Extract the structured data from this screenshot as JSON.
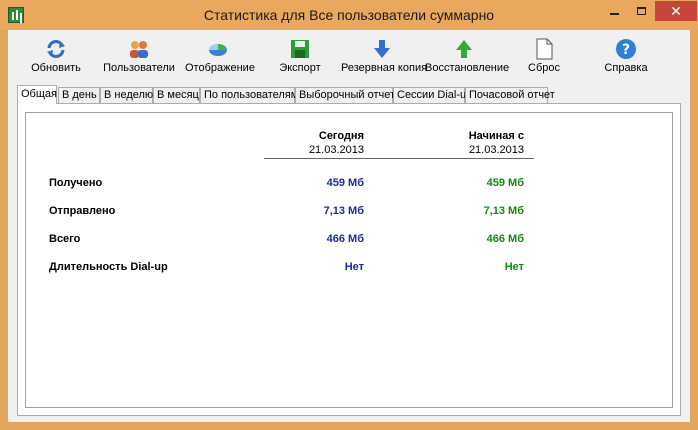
{
  "window": {
    "title": "Статистика для Все пользователи суммарно",
    "close_glyph": "✕",
    "colors": {
      "frame": "#e9a85e",
      "close": "#c7453b"
    }
  },
  "toolbar": {
    "items": [
      {
        "label": "Обновить",
        "icon": "refresh-icon"
      },
      {
        "label": "Пользователи",
        "icon": "users-icon"
      },
      {
        "label": "Отображение",
        "icon": "pie-chart-icon"
      },
      {
        "label": "Экспорт",
        "icon": "floppy-disk-icon"
      },
      {
        "label": "Резервная копия",
        "icon": "arrow-down-icon"
      },
      {
        "label": "Восстановление",
        "icon": "arrow-up-icon"
      },
      {
        "label": "Сброс",
        "icon": "blank-document-icon"
      },
      {
        "label": "Справка",
        "icon": "help-icon"
      }
    ]
  },
  "tabs": [
    {
      "label": "Общая",
      "active": true
    },
    {
      "label": "В день"
    },
    {
      "label": "В неделю"
    },
    {
      "label": "В месяц"
    },
    {
      "label": "По пользователям"
    },
    {
      "label": "Выборочный отчет"
    },
    {
      "label": "Сессии Dial-up"
    },
    {
      "label": "Почасовой отчет"
    }
  ],
  "stats": {
    "columns": [
      {
        "title": "Сегодня",
        "date": "21.03.2013"
      },
      {
        "title": "Начиная с",
        "date": "21.03.2013"
      }
    ],
    "rows": [
      {
        "label": "Получено",
        "today": "459 Мб",
        "since": "459 Мб"
      },
      {
        "label": "Отправлено",
        "today": "7,13 Мб",
        "since": "7,13 Мб"
      },
      {
        "label": "Всего",
        "today": "466 Мб",
        "since": "466 Мб"
      },
      {
        "label": "Длительность Dial-up",
        "today": "Нет",
        "since": "Нет"
      }
    ],
    "colors": {
      "today": "#1c2b9a",
      "since": "#128a12"
    }
  }
}
